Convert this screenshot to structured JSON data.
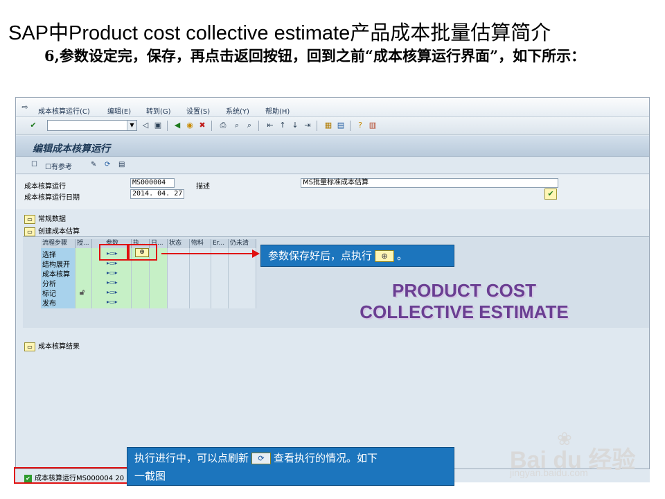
{
  "slide": {
    "title": "SAP中Product cost collective estimate产品成本批量估算简介",
    "body": "6,参数设定完，保存，再点击返回按钮，回到之前“成本核算运行界面”，如下所示："
  },
  "menubar": {
    "items": [
      "成本核算运行(C)",
      "编辑(E)",
      "转到(G)",
      "设置(S)",
      "系统(Y)",
      "帮助(H)"
    ]
  },
  "screen": {
    "title": "编辑成本核算运行",
    "toolbar": {
      "with_ref_label": "有参考"
    }
  },
  "fields": {
    "run_label": "成本核算运行",
    "run_value": "MS000004",
    "desc_label": "描述",
    "desc_value": "MS批量标准成本估算",
    "date_label": "成本核算运行日期",
    "date_value": "2014. 04. 27"
  },
  "sections": {
    "general": "常规数据",
    "create": "创建成本估算",
    "results": "成本核算结果"
  },
  "grid": {
    "headers": [
      "流程步骤",
      "授...",
      "参数",
      "执...",
      "日...",
      "状态",
      "物料",
      "Er...",
      "仍未清"
    ],
    "steps": [
      "选择",
      "结构展开",
      "成本核算",
      "分析",
      "标记",
      "发布"
    ],
    "param_glyph": "▸▭▸"
  },
  "callouts": {
    "execute": "参数保存好后，点执行",
    "execute_end": "。",
    "refresh_1": "执行进行中，可以点刷新",
    "refresh_2": "查看执行的情况。如下",
    "refresh_3": "一截图"
  },
  "overlay_title": {
    "line1": "PRODUCT COST",
    "line2": "COLLECTIVE ESTIMATE"
  },
  "status": {
    "text": "成本核算运行MS000004 20"
  },
  "watermark": {
    "brand": "Bai du 经验",
    "url": "jingyan.baidu.com"
  }
}
